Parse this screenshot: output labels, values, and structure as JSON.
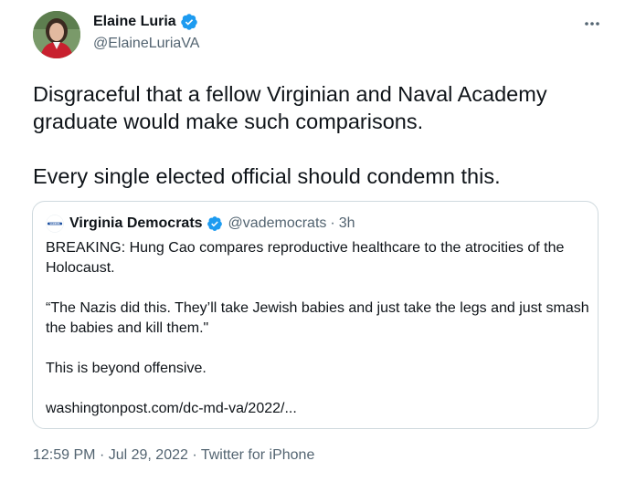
{
  "author": {
    "name": "Elaine Luria",
    "handle": "@ElaineLuriaVA",
    "verified": true,
    "avatar_icon": "profile-photo"
  },
  "tweet": {
    "paragraphs": [
      "Disgraceful that a fellow Virginian and Naval Academy graduate would make such comparisons.",
      "Every single elected official should condemn this."
    ]
  },
  "quote": {
    "name": "Virginia Democrats",
    "handle": "@vademocrats",
    "separator": "·",
    "time": "3h",
    "logo_text": "VADEMS",
    "lines": {
      "breaking": "BREAKING: Hung Cao compares reproductive healthcare to the atrocities of the Holocaust.",
      "quote": "“The Nazis did this. They’ll take Jewish babies and just take the legs and just smash the babies and kill them.\"",
      "offensive": "This is beyond offensive.",
      "link": "washingtonpost.com/dc-md-va/2022/..."
    }
  },
  "meta": {
    "time": "12:59 PM",
    "separator1": "·",
    "date": "Jul 29, 2022",
    "separator2": "·",
    "client": "Twitter for iPhone"
  },
  "colors": {
    "verified_blue": "#1d9bf0",
    "secondary_text": "#536471",
    "border": "#cfd9de"
  }
}
